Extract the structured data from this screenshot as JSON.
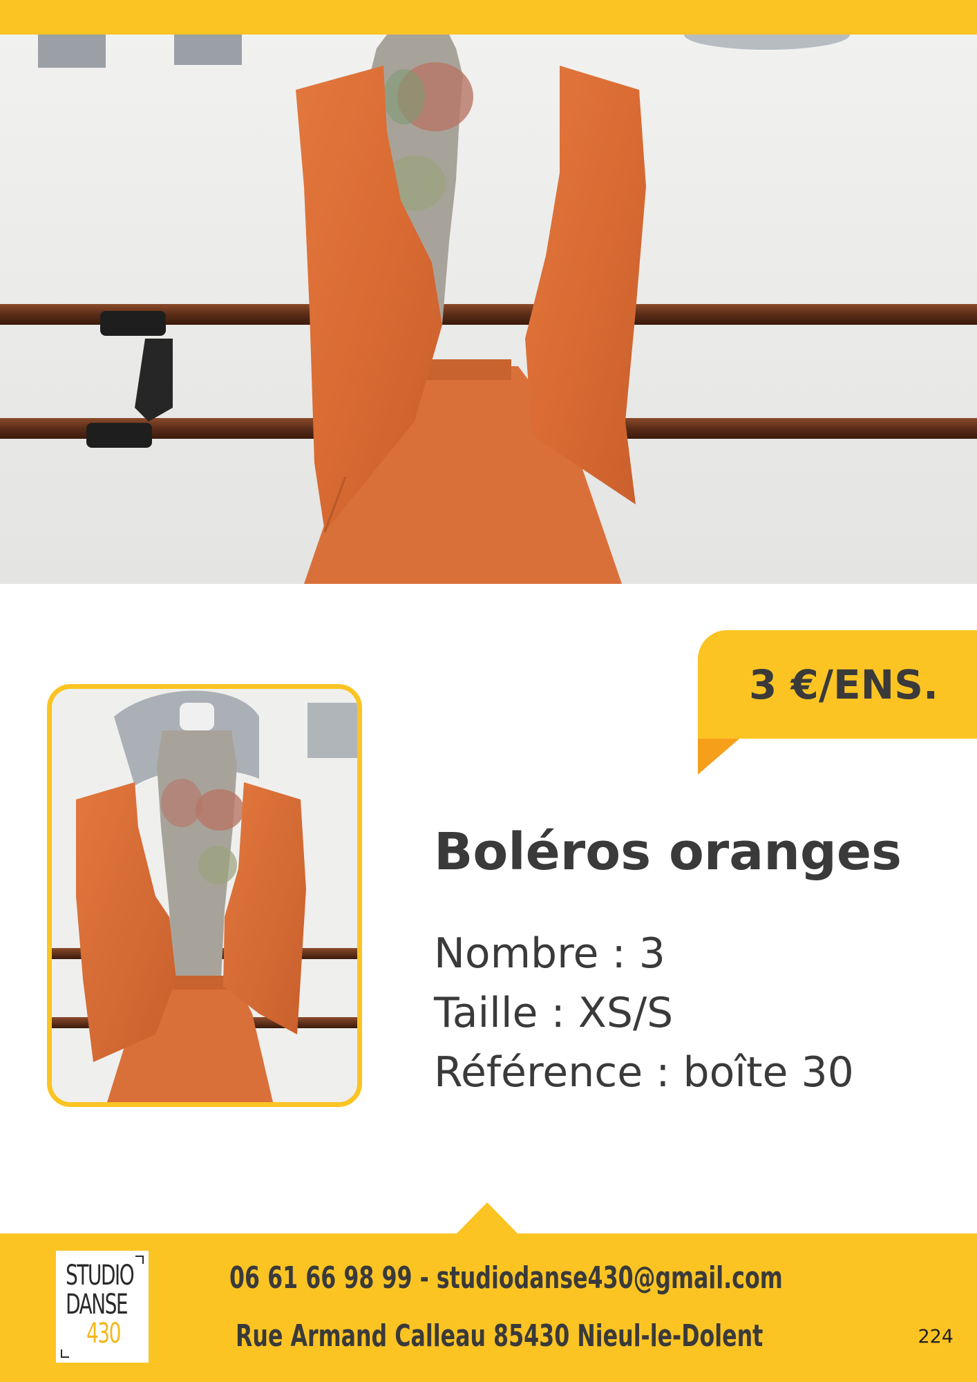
{
  "price": {
    "label": "3 €/ENS."
  },
  "product": {
    "title": "Boléros oranges",
    "count": "Nombre : 3",
    "size": "Taille : XS/S",
    "reference": "Référence : boîte 30"
  },
  "footer": {
    "logo_line1": "STUDIO",
    "logo_line2": "DANSE",
    "logo_line3": "430",
    "contact_line1": "06 61 66 98 99 - studiodanse430@gmail.com",
    "contact_line2": "Rue Armand Calleau 85430 Nieul-le-Dolent",
    "page_number": "224"
  },
  "colors": {
    "accent_yellow": "#fbc423",
    "accent_orange": "#f59f1b",
    "text_dark": "#3a3a3a",
    "garment_orange": "#d9703a"
  },
  "images": {
    "hero": "photo-orange-bolero-on-mannequin",
    "thumbnail": "photo-orange-bolero-on-mannequin-thumbnail"
  }
}
